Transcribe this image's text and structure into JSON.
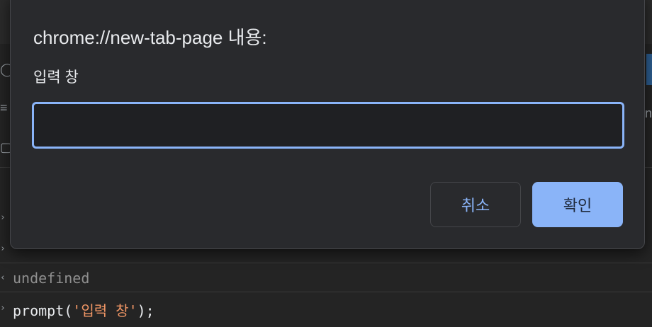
{
  "dialog": {
    "title": "chrome://new-tab-page 내용:",
    "message": "입력 창",
    "input_value": "",
    "cancel_label": "취소",
    "ok_label": "확인"
  },
  "console": {
    "output_value": "undefined",
    "input_command_prefix": "prompt(",
    "input_command_string": "'입력 창'",
    "input_command_suffix": ");"
  },
  "colors": {
    "accent": "#8ab4f8",
    "dialog_bg": "#292a2d",
    "string_literal": "#f29766"
  }
}
